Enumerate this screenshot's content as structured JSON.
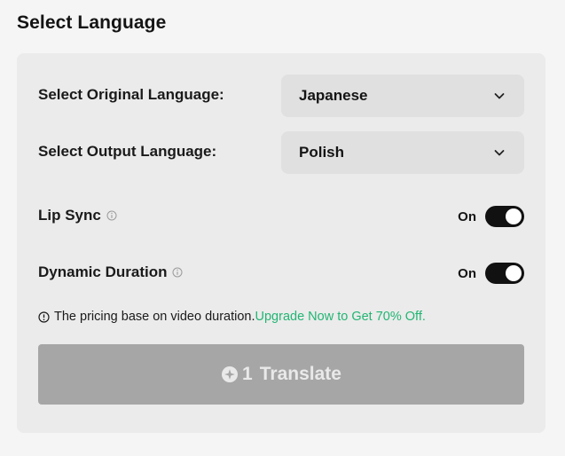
{
  "section": {
    "title": "Select Language"
  },
  "original_language": {
    "label": "Select Original Language:",
    "value": "Japanese"
  },
  "output_language": {
    "label": "Select Output Language:",
    "value": "Polish"
  },
  "lip_sync": {
    "label": "Lip Sync",
    "state_label": "On",
    "enabled": true
  },
  "dynamic_duration": {
    "label": "Dynamic Duration",
    "state_label": "On",
    "enabled": true
  },
  "notice": {
    "text": "The pricing base on video duration.",
    "link": "Upgrade Now to Get 70% Off."
  },
  "translate_button": {
    "count": "1",
    "label": "Translate"
  },
  "colors": {
    "accent_link": "#22b573",
    "toggle_on": "#111111",
    "button_disabled": "#a6a6a6"
  },
  "icons": {
    "dropdown": "chevron-down-icon",
    "info": "info-icon",
    "notice": "alert-circle-icon",
    "credit": "credit-coin-icon"
  }
}
